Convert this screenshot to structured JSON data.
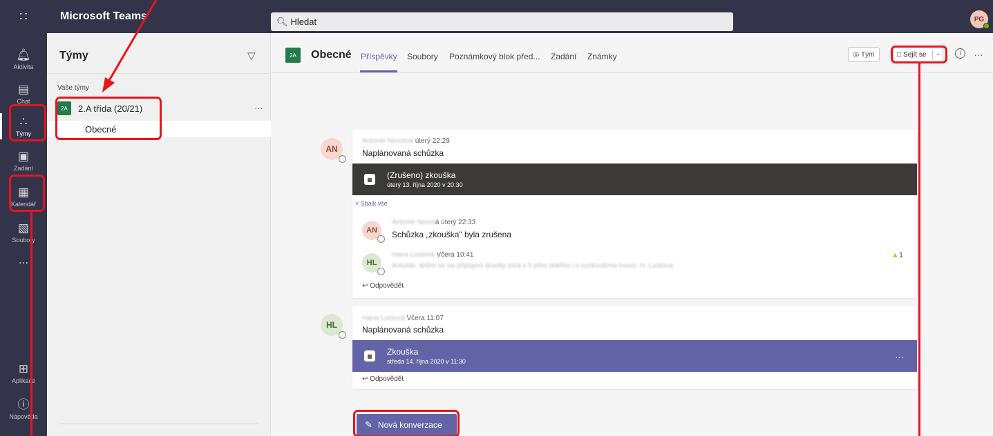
{
  "topbar": {
    "app_title": "Microsoft Teams",
    "search_placeholder": "Hledat",
    "user_initials": "PG"
  },
  "rail": {
    "items": [
      {
        "label": "Aktivita",
        "icon": "bell-icon"
      },
      {
        "label": "Chat",
        "icon": "chat-icon"
      },
      {
        "label": "Týmy",
        "icon": "teams-icon"
      },
      {
        "label": "Zadání",
        "icon": "assignments-icon"
      },
      {
        "label": "Kalendář",
        "icon": "calendar-icon"
      },
      {
        "label": "Soubory",
        "icon": "files-icon"
      },
      {
        "label": "...",
        "icon": "more-icon"
      },
      {
        "label": "Aplikace",
        "icon": "apps-icon"
      },
      {
        "label": "Nápověda",
        "icon": "help-icon"
      }
    ]
  },
  "teams_pane": {
    "title": "Týmy",
    "section_label": "Vaše týmy",
    "team": {
      "badge": "2A",
      "name": "2.A třída (20/21)"
    },
    "channel": "Obecné"
  },
  "channel": {
    "badge": "2A",
    "title": "Obecné",
    "tabs": [
      "Příspěvky",
      "Soubory",
      "Poznámkový blok před...",
      "Zadání",
      "Známky"
    ],
    "team_button": "Tým",
    "meet_button": "Sejít se"
  },
  "posts": [
    {
      "avatar": "AN",
      "author_blurred": "Antonie Novotná",
      "time": "úterý 22:29",
      "text": "Naplánovaná schůzka",
      "meeting": {
        "title": "(Zrušeno) zkouška",
        "when": "úterý 13. října 2020 v 20:30",
        "color": "#3b3a39"
      },
      "collapse_label": "Sbalit vše",
      "replies": [
        {
          "avatar": "AN",
          "author_blurred": "Antonie Novot",
          "author_suffix": "á",
          "time": "úterý 22:33",
          "text": "Schůzka „zkouška\" byla zrušena"
        },
        {
          "avatar": "HL",
          "author_blurred": "Hana Lustová",
          "time": "Včera 10:41",
          "text_blurred": "Antonie, těším se na připojení dcerky zítra v 5 přes telefon i s vyzkoušíme hovor. H. Lustová",
          "likes": "1"
        }
      ],
      "reply_label": "Odpovědět"
    },
    {
      "avatar": "HL",
      "author_blurred": "Hana Lustová",
      "time": "Včera 11:07",
      "text": "Naplánovaná schůzka",
      "meeting": {
        "title": "Zkouška",
        "when": "středa 14. října 2020 v 11:30",
        "color": "#6264a7"
      },
      "reply_label": "Odpovědět"
    }
  ],
  "new_conversation": "Nová konverzace",
  "annotation_color": "#e8141c"
}
